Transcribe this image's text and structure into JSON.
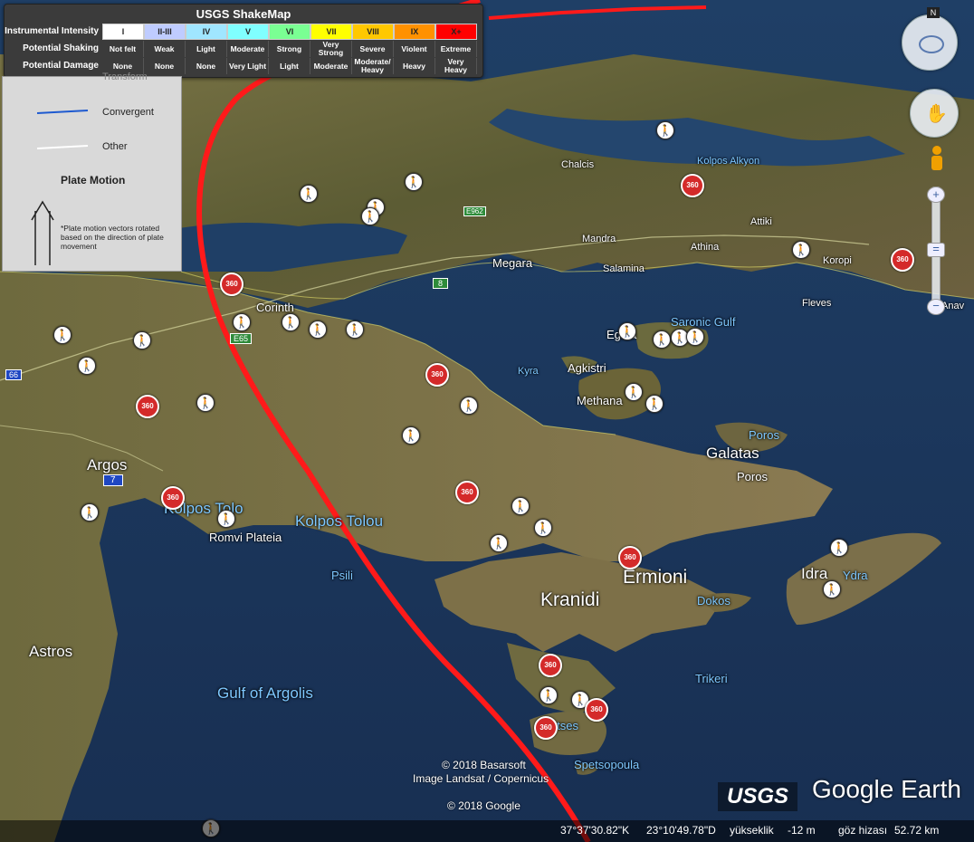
{
  "legend": {
    "title": "USGS ShakeMap",
    "row_labels": [
      "Instrumental Intensity",
      "Potential Shaking",
      "Potential Damage"
    ],
    "intensity": [
      "I",
      "II-III",
      "IV",
      "V",
      "VI",
      "VII",
      "VIII",
      "IX",
      "X+"
    ],
    "intensity_colors": [
      "#ffffff",
      "#bfccff",
      "#a0e6ff",
      "#80ffff",
      "#7aff93",
      "#ffff00",
      "#ffc800",
      "#ff9100",
      "#ff0000"
    ],
    "shaking": [
      "Not felt",
      "Weak",
      "Light",
      "Moderate",
      "Strong",
      "Very Strong",
      "Severe",
      "Violent",
      "Extreme"
    ],
    "damage": [
      "None",
      "None",
      "None",
      "Very Light",
      "Light",
      "Moderate",
      "Moderate/ Heavy",
      "Heavy",
      "Very Heavy"
    ]
  },
  "plate_legend": {
    "transform": "Transform",
    "convergent": "Convergent",
    "other": "Other",
    "plate_motion": "Plate Motion",
    "note": "*Plate motion vectors rotated based on the direction of plate movement"
  },
  "places": {
    "corinth": "Corinth",
    "megara": "Megara",
    "mandra": "Mandra",
    "salamina": "Salamina",
    "athina": "Athina",
    "attiki": "Attiki",
    "koropi": "Koropi",
    "anavyssos": "Anav",
    "fleves": "Fleves",
    "chalkida": "Chalcis",
    "kolpos_alkyonidon": "Kolpos Alkyon",
    "saronic_gulf": "Saronic Gulf",
    "egina": "Egina",
    "agkistri": "Agkistri",
    "kyra": "Kyra",
    "methana": "Methana",
    "poros": "Poros",
    "galatas": "Galatas",
    "poros2": "Poros",
    "argos": "Argos",
    "kolpos_tolo_1": "Kolpos Tolo",
    "kolpos_tolou": "Kolpos Tolou",
    "romvi_plateia": "Romvi Plateia",
    "psili": "Psili",
    "kranidi": "Kranidi",
    "ermioni": "Ermioni",
    "dokos": "Dokos",
    "idra": "Idra",
    "ydra": "Ydra",
    "astros": "Astros",
    "gulf_of_argolis": "Gulf of Argolis",
    "trikeri": "Trikeri",
    "spetses": "Spetses",
    "spetsopoula": "Spetsopoula"
  },
  "roads": {
    "e65": "E65",
    "r8": "8",
    "r7": "7",
    "r66": "66",
    "e962": "E962",
    "r8b": "8"
  },
  "attribution": {
    "line1": "© 2018 Basarsoft",
    "line2": "Image Landsat / Copernicus",
    "line3": "© 2018 Google"
  },
  "logos": {
    "usgs": "USGS",
    "google_earth": "Google Earth"
  },
  "statusbar": {
    "lat": "37°37'30.82\"K",
    "lon": "23°10'49.78\"D",
    "elev_label": "yükseklik",
    "elev_value": "-12 m",
    "eye_label": "göz hizası",
    "eye_value": "52.72 km"
  },
  "colors": {
    "fault": "#ff1a1a",
    "water": "#1e3f66",
    "land": "#6b6a3c"
  },
  "icons": [
    "compass-icon",
    "look-icon",
    "move-icon",
    "pegman-icon",
    "zoom-in-icon",
    "zoom-out-icon",
    "hiking-icon",
    "panorama-360-icon"
  ]
}
